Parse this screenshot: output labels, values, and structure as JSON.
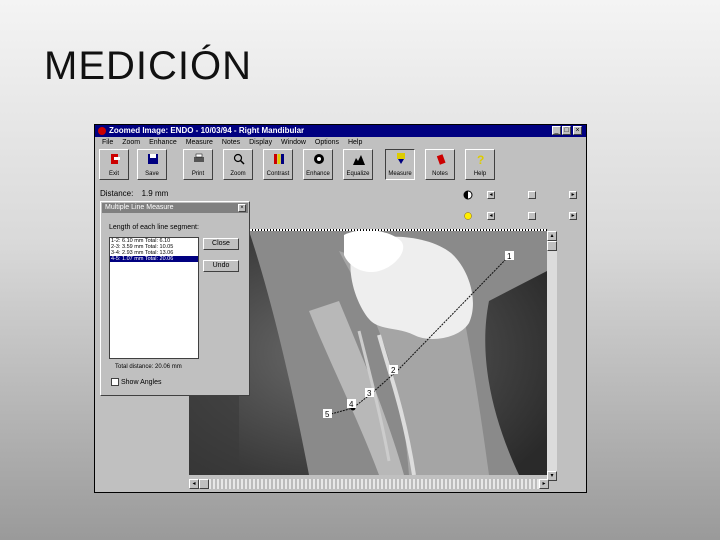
{
  "slide": {
    "title": "MEDICIÓN"
  },
  "window": {
    "title": "Zoomed Image: ENDO - 10/03/94 - Right Mandibular",
    "controls": [
      "_",
      "□",
      "×"
    ]
  },
  "menu": [
    "File",
    "Zoom",
    "Enhance",
    "Measure",
    "Notes",
    "Display",
    "Window",
    "Options",
    "Help"
  ],
  "toolbar": [
    {
      "label": "Exit",
      "icon": "exit-icon",
      "color": "#cc0000"
    },
    {
      "label": "Save",
      "icon": "save-icon",
      "color": "#000080"
    },
    {
      "label": "Print",
      "icon": "print-icon",
      "color": "#333333"
    },
    {
      "label": "Zoom",
      "icon": "zoom-icon",
      "color": "#333333"
    },
    {
      "label": "Contrast",
      "icon": "contrast-icon",
      "color": "#cc8800"
    },
    {
      "label": "Enhance",
      "icon": "enhance-icon",
      "color": "#000000"
    },
    {
      "label": "Equalize",
      "icon": "equalize-icon",
      "color": "#000000"
    },
    {
      "label": "Measure",
      "icon": "measure-icon",
      "color": "#ddcc00"
    },
    {
      "label": "Notes",
      "icon": "notes-icon",
      "color": "#cc0000"
    },
    {
      "label": "Help",
      "icon": "help-icon",
      "color": "#ddcc00"
    }
  ],
  "distance": {
    "label": "Distance:",
    "value": "1.9 mm"
  },
  "dialog": {
    "title": "Multiple Line Measure",
    "close": "×",
    "label": "Length of each line segment:",
    "segments": [
      "1-2: 6.10 mm  Total: 6.10",
      "2-3: 3.59 mm  Total: 10.05",
      "3-4: 2.93 mm  Total: 13.06",
      "4-5: 1.07 mm  Total: 20.06"
    ],
    "selected_index": 3,
    "close_button": "Close",
    "undo_button": "Undo",
    "total_label": "Total distance: 20.06 mm",
    "show_angles": "Show Angles"
  },
  "measure_points": [
    "1",
    "2",
    "3",
    "4",
    "5"
  ]
}
